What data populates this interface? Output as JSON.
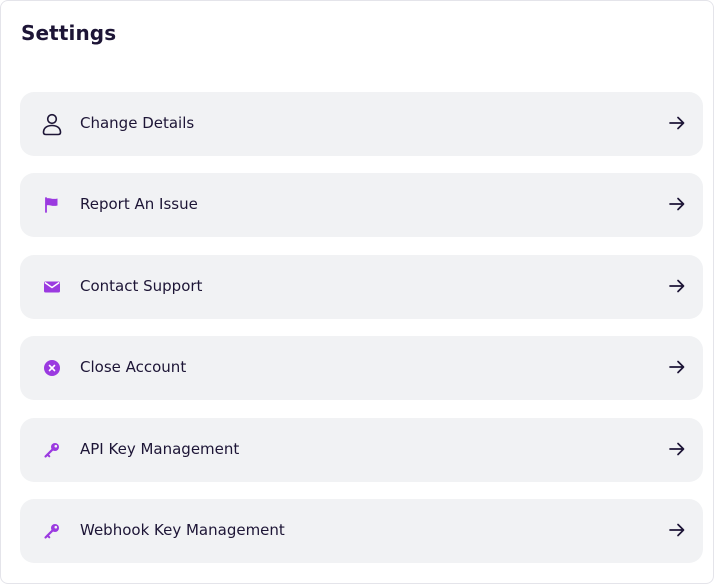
{
  "page": {
    "title": "Settings"
  },
  "colors": {
    "accent": "#9b3ae0",
    "text": "#1d1536",
    "row_background": "#f1f2f4"
  },
  "settings": {
    "items": [
      {
        "label": "Change Details",
        "icon": "user-icon"
      },
      {
        "label": "Report An Issue",
        "icon": "flag-icon"
      },
      {
        "label": "Contact Support",
        "icon": "mail-icon"
      },
      {
        "label": "Close Account",
        "icon": "close-circle-icon"
      },
      {
        "label": "API Key Management",
        "icon": "key-icon"
      },
      {
        "label": "Webhook Key Management",
        "icon": "key-icon"
      }
    ]
  }
}
